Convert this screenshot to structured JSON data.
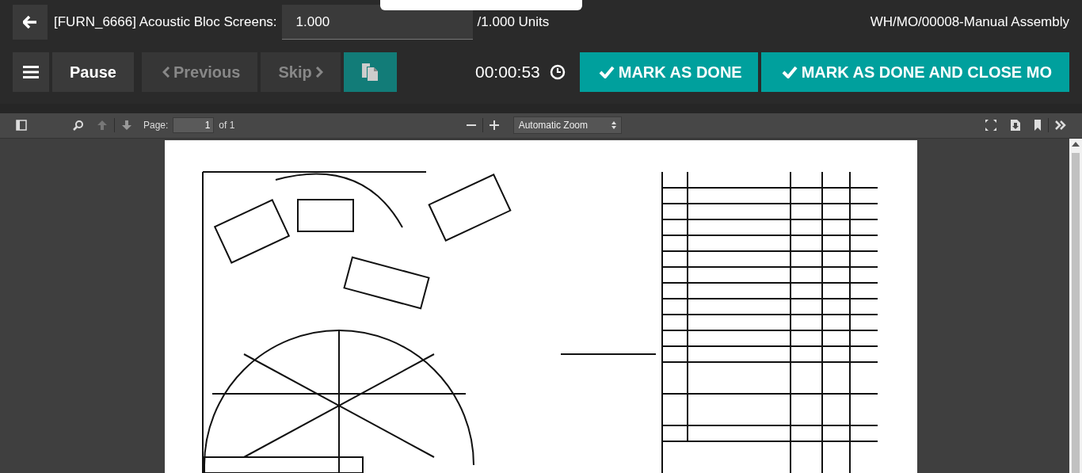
{
  "header": {
    "product": "[FURN_6666] Acoustic Bloc Screens:",
    "quantity": "1.000",
    "total": "/1.000 Units",
    "reference": "WH/MO/00008-Manual Assembly"
  },
  "actions": [
    {
      "kind": "menu"
    },
    {
      "kind": "text",
      "label": "Pause",
      "disabled": false
    },
    {
      "kind": "prev",
      "label": "Previous",
      "disabled": true
    },
    {
      "kind": "next",
      "label": "Skip",
      "disabled": true
    },
    {
      "kind": "copy"
    }
  ],
  "timer": "00:00:53",
  "done_buttons": [
    "MARK AS DONE",
    "MARK AS DONE AND CLOSE MO"
  ],
  "viewer": {
    "page_label": "Page:",
    "page": "1",
    "page_count": "of 1",
    "zoom": "Automatic Zoom"
  }
}
